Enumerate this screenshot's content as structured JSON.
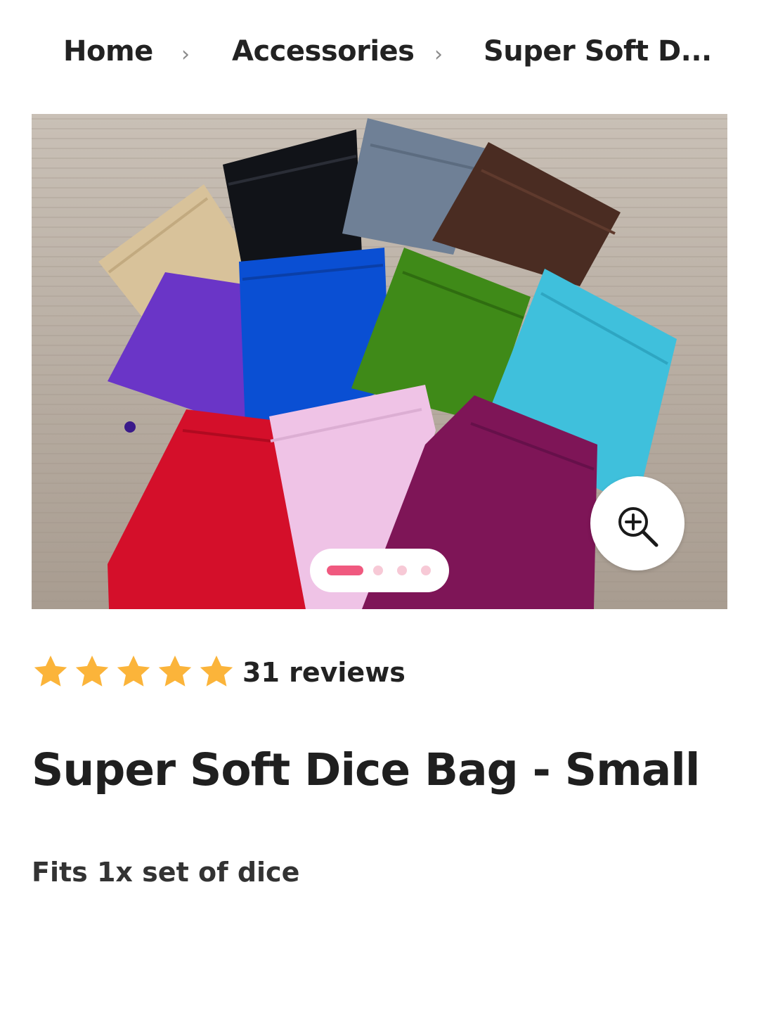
{
  "breadcrumb": {
    "items": [
      "Home",
      "Accessories",
      "Super Soft D..."
    ],
    "separator": "›"
  },
  "gallery": {
    "image_alt": "Twelve velvet drawstring dice bags in assorted colors on a wooden table",
    "bag_colors": [
      "#d8c29a",
      "#111318",
      "#6f8096",
      "#4a2c22",
      "#6a35c7",
      "#0a4fd3",
      "#3f8a18",
      "#3fc0dc",
      "#d40f2a",
      "#efc3e6",
      "#7e1557"
    ],
    "zoom_icon": "zoom-in-icon",
    "slide_count": 4,
    "active_slide": 1
  },
  "colors": {
    "accent": "#f0597f",
    "dot_inactive": "#f7c9d6",
    "star": "#fbb43a"
  },
  "rating": {
    "stars": 5,
    "reviews_label": "31 reviews"
  },
  "product": {
    "title": "Super Soft Dice Bag - Small",
    "subtitle": "Fits 1x set of dice"
  }
}
